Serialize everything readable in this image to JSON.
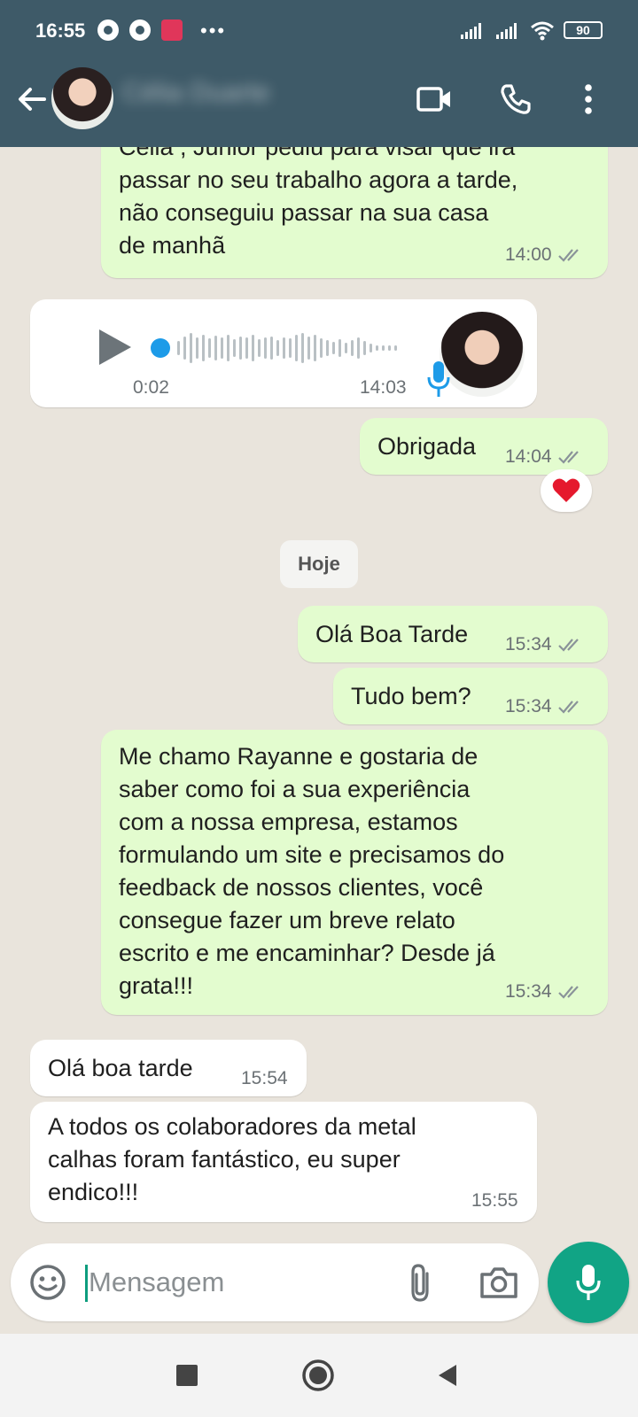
{
  "status_bar": {
    "time": "16:55",
    "more": "•••",
    "battery": "90"
  },
  "header": {
    "contact_name": "Célia Duarte"
  },
  "messages": [
    {
      "direction": "out",
      "text": "Celia , Junior pediu para visar que irá\npassar no seu trabalho agora a tarde,\nnão conseguiu passar na sua casa\nde manhã",
      "time": "14:00"
    },
    {
      "direction": "in",
      "type": "voice",
      "duration": "0:02",
      "time": "14:03"
    },
    {
      "direction": "out",
      "text": "Obrigada",
      "time": "14:04",
      "reaction": "❤️"
    },
    {
      "direction": "out",
      "text": "Olá Boa Tarde",
      "time": "15:34"
    },
    {
      "direction": "out",
      "text": "Tudo bem?",
      "time": "15:34"
    },
    {
      "direction": "out",
      "text": "Me chamo Rayanne e gostaria de\nsaber como foi  a sua experiência\ncom a nossa empresa, estamos\nformulando um site e precisamos do\nfeedback de nossos clientes, você\nconsegue fazer um breve relato\nescrito e me encaminhar? Desde já\ngrata!!!",
      "time": "15:34"
    },
    {
      "direction": "in",
      "text": "Olá boa tarde",
      "time": "15:54"
    },
    {
      "direction": "in",
      "text": "A todos os colaboradores da metal\ncalhas foram fantástico, eu super\nendico!!!",
      "time": "15:55"
    }
  ],
  "date_divider": "Hoje",
  "composer": {
    "placeholder": "Mensagem"
  },
  "colors": {
    "header": "#3e5a68",
    "outgoing": "#e3fccf",
    "incoming": "#ffffff",
    "accent": "#11a485",
    "ticks": "#8a9399"
  },
  "icons": [
    "back-arrow-icon",
    "video-call-icon",
    "phone-icon",
    "more-vert-icon",
    "play-icon",
    "mic-icon",
    "emoji-icon",
    "attach-icon",
    "camera-icon",
    "nav-recents-icon",
    "nav-home-icon",
    "nav-back-icon"
  ]
}
